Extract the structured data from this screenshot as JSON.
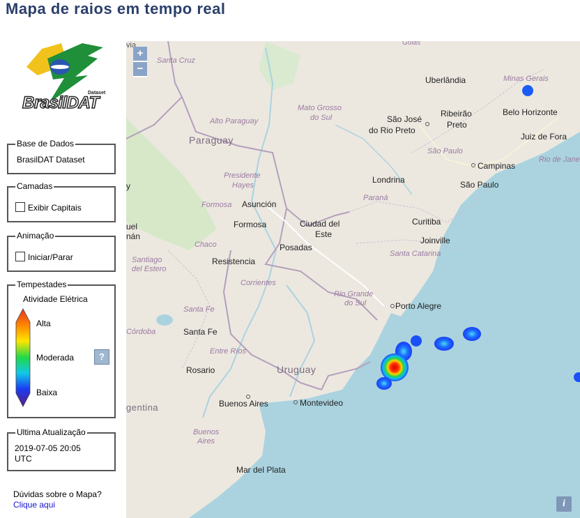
{
  "page": {
    "title": "Mapa de raios em tempo real"
  },
  "logo": {
    "text": "BrasilDAT",
    "sub": "Dataset"
  },
  "panels": {
    "database": {
      "title": "Base de Dados",
      "value": "BrasilDAT Dataset"
    },
    "layers": {
      "title": "Camadas",
      "option": "Exibir Capitais"
    },
    "animation": {
      "title": "Animação",
      "option": "Iniciar/Parar"
    },
    "storms": {
      "title": "Tempestades",
      "subtitle": "Atividade Elétrica",
      "high": "Alta",
      "moderate": "Moderada",
      "low": "Baixa",
      "help": "?"
    },
    "update": {
      "title": "Ultima Atualização",
      "value": "2019-07-05 20:05 UTC"
    }
  },
  "footer": {
    "question": "Dúvidas sobre o Mapa?",
    "link": "Clique aqui"
  },
  "map": {
    "zoom_in": "+",
    "zoom_out": "−",
    "info": "i",
    "labels": {
      "goias": "Goiás",
      "santa_cruz": "Santa Cruz",
      "uberlandia": "Uberlândia",
      "minas_gerais": "Minas Gerais",
      "mato_grosso_do_sul_1": "Mato Grosso",
      "mato_grosso_do_sul_2": "do Sul",
      "belo_horizonte": "Belo Horizonte",
      "ribeirao_1": "Ribeirão",
      "ribeirao_2": "Preto",
      "sao_jose_1": "São José",
      "sao_jose_2": "do Rio Preto",
      "juiz_de_fora": "Juiz de Fora",
      "alto_paraguay": "Alto Paraguay",
      "paraguay": "Paraguay",
      "sao_paulo_state": "São Paulo",
      "rio_de_janeiro": "Rio de Jane",
      "campinas": "Campinas",
      "sao_paulo": "São Paulo",
      "presidente_1": "Presidente",
      "presidente_2": "Hayes",
      "londrina": "Londrina",
      "parana": "Paraná",
      "formosa_state": "Formosa",
      "asuncion": "Asunción",
      "formosa": "Formosa",
      "ciudad_1": "Ciudad del",
      "ciudad_2": "Este",
      "curitiba": "Curitiba",
      "joinville": "Joinville",
      "chaco": "Chaco",
      "posadas": "Posadas",
      "resistencia": "Resistencia",
      "santa_catarina": "Santa Catarina",
      "santiago_1": "Santiago",
      "santiago_2": "del Estero",
      "corrientes": "Corrientes",
      "rio_grande_1": "Rio Grande",
      "rio_grande_2": "do Sul",
      "porto_alegre": "Porto Alegre",
      "santa_fe_state": "Santa Fe",
      "cordoba": "Córdoba",
      "santa_fe": "Santa Fe",
      "entre_rios": "Entre Ríos",
      "rosario": "Rosario",
      "uruguay": "Uruguay",
      "argentina": "gentina",
      "buenos_aires": "Buenos Aires",
      "montevideo": "Montevideo",
      "buenos_aires_prov_1": "Buenos",
      "buenos_aires_prov_2": "Aires",
      "mar_del_plata": "Mar del Plata",
      "edge_uel": "uel",
      "edge_nan": "nán",
      "edge_via": "via",
      "edge_y": "y"
    }
  },
  "colors": {
    "title": "#2b3f6b",
    "link": "#1515d4",
    "ocean": "#aad3df",
    "land": "#ece8e0"
  }
}
